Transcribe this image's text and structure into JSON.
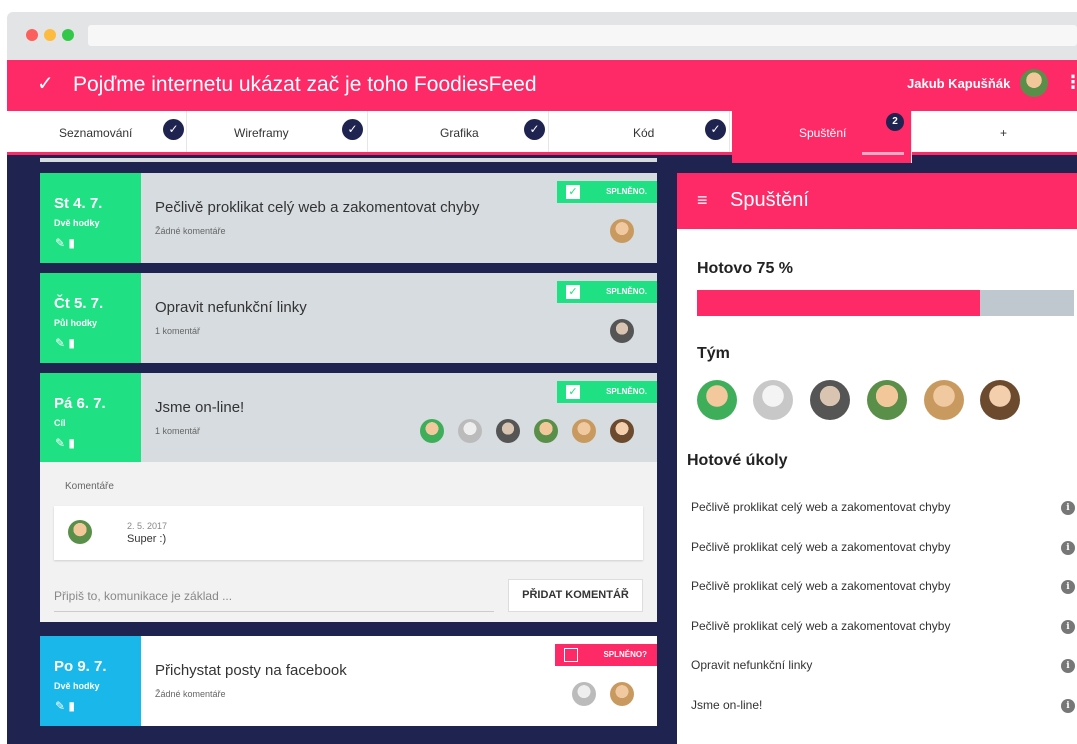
{
  "app": {
    "title": "Pojďme internetu ukázat zač je toho FoodiesFeed",
    "check_glyph": "✓",
    "user_name": "Jakub Kapušňák",
    "more_glyph": "⋮"
  },
  "tabs": [
    {
      "label": "Seznamování",
      "done": true
    },
    {
      "label": "Wireframy",
      "done": true
    },
    {
      "label": "Grafika",
      "done": true
    },
    {
      "label": "Kód",
      "done": true
    },
    {
      "label": "Spuštění",
      "done": false,
      "badge": "2",
      "active": true
    },
    {
      "label": "+",
      "done": false
    }
  ],
  "tasks": [
    {
      "day": "St 4. 7.",
      "duration": "Dvě hodky",
      "title": "Pečlivě proklikat celý web a zakomentovat chyby",
      "comments": "Žádné komentáře",
      "status": "SPLNĚNO."
    },
    {
      "day": "Čt 5. 7.",
      "duration": "Půl hodky",
      "title": "Opravit nefunkční linky",
      "comments": "1 komentář",
      "status": "SPLNĚNO."
    },
    {
      "day": "Pá 6. 7.",
      "duration": "Cíl",
      "title": "Jsme on-line!",
      "comments": "1 komentář",
      "status": "SPLNĚNO."
    },
    {
      "day": "Po 9. 7.",
      "duration": "Dvě hodky",
      "title": "Přichystat posty na facebook",
      "comments": "Žádné komentáře",
      "status": "SPLNĚNO?"
    }
  ],
  "comments": {
    "label": "Komentáře",
    "date": "2. 5. 2017",
    "text": "Super :)",
    "input_placeholder": "Připiš to, komunikace je základ ...",
    "add_button": "PŘIDAT KOMENTÁŘ"
  },
  "panel": {
    "title": "Spuštění",
    "menu_glyph": "≡",
    "done_label": "Hotovo 75 %",
    "progress": 0.75,
    "team_label": "Tým",
    "tasks_label": "Hotové úkoly",
    "done_tasks": [
      "Pečlivě proklikat celý web a zakomentovat chyby",
      "Pečlivě proklikat celý web a zakomentovat chyby",
      "Pečlivě proklikat celý web a zakomentovat chyby",
      "Pečlivě proklikat celý web a zakomentovat chyby",
      "Opravit nefunkční linky",
      "Jsme on-line!"
    ],
    "info_glyph": "i"
  },
  "icons": {
    "edit": "✎",
    "delete": "▮",
    "check": "✓"
  },
  "colors": {
    "accent": "#fd2a67",
    "done_green": "#1fe183",
    "upcoming_blue": "#1ab7ea",
    "navy": "#1f2350"
  }
}
